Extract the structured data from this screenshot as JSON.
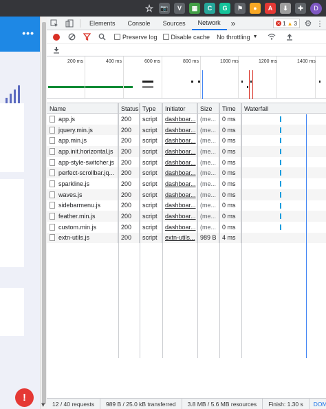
{
  "browser": {
    "extensions": [
      {
        "name": "star-icon",
        "glyph": "☆",
        "bg": "transparent"
      },
      {
        "name": "camera-extension-icon",
        "glyph": "📷",
        "bg": "#5f6368"
      },
      {
        "name": "italic-v-extension-icon",
        "glyph": "V",
        "bg": "#5f6368"
      },
      {
        "name": "grid-extension-icon",
        "glyph": "▦",
        "bg": "#43a047"
      },
      {
        "name": "c-extension-icon",
        "glyph": "C",
        "bg": "#26a69a"
      },
      {
        "name": "grammarly-extension-icon",
        "glyph": "G",
        "bg": "#15c39a"
      },
      {
        "name": "flag-extension-icon",
        "glyph": "⚑",
        "bg": "#5f6368"
      },
      {
        "name": "honey-extension-icon",
        "glyph": "●",
        "bg": "#f9a825"
      },
      {
        "name": "pdf-extension-icon",
        "glyph": "A",
        "bg": "#e53935"
      },
      {
        "name": "download-extension-icon",
        "glyph": "⬇",
        "bg": "#9e9e9e"
      },
      {
        "name": "puzzle-extension-icon",
        "glyph": "✚",
        "bg": "#5f6368"
      }
    ],
    "avatar_letter": "D"
  },
  "page": {
    "menu_dots": "•••",
    "alert_glyph": "!"
  },
  "devtools": {
    "tabs": [
      {
        "name": "tab-elements",
        "label": "Elements",
        "active": false
      },
      {
        "name": "tab-console",
        "label": "Console",
        "active": false
      },
      {
        "name": "tab-sources",
        "label": "Sources",
        "active": false
      },
      {
        "name": "tab-network",
        "label": "Network",
        "active": true
      }
    ],
    "more_tabs": "»",
    "errors": "1",
    "warnings": "3",
    "toolbar": {
      "preserve_log": "Preserve log",
      "disable_cache": "Disable cache",
      "throttling": "No throttling"
    },
    "overview_ticks": [
      "200 ms",
      "400 ms",
      "600 ms",
      "800 ms",
      "1000 ms",
      "1200 ms",
      "1400 ms"
    ],
    "columns": {
      "name": "Name",
      "status": "Status",
      "type": "Type",
      "initiator": "Initiator",
      "size": "Size",
      "time": "Time",
      "waterfall": "Waterfall"
    },
    "requests": [
      {
        "name": "app.js",
        "status": "200",
        "type": "script",
        "initiator": "dashboar...",
        "size": "(me...",
        "time": "0 ms"
      },
      {
        "name": "jquery.min.js",
        "status": "200",
        "type": "script",
        "initiator": "dashboar...",
        "size": "(me...",
        "time": "0 ms"
      },
      {
        "name": "app.min.js",
        "status": "200",
        "type": "script",
        "initiator": "dashboar...",
        "size": "(me...",
        "time": "0 ms"
      },
      {
        "name": "app.init.horizontal.js",
        "status": "200",
        "type": "script",
        "initiator": "dashboar...",
        "size": "(me...",
        "time": "0 ms"
      },
      {
        "name": "app-style-switcher.js",
        "status": "200",
        "type": "script",
        "initiator": "dashboar...",
        "size": "(me...",
        "time": "0 ms"
      },
      {
        "name": "perfect-scrollbar.jq...",
        "status": "200",
        "type": "script",
        "initiator": "dashboar...",
        "size": "(me...",
        "time": "0 ms"
      },
      {
        "name": "sparkline.js",
        "status": "200",
        "type": "script",
        "initiator": "dashboar...",
        "size": "(me...",
        "time": "0 ms"
      },
      {
        "name": "waves.js",
        "status": "200",
        "type": "script",
        "initiator": "dashboar...",
        "size": "(me...",
        "time": "0 ms"
      },
      {
        "name": "sidebarmenu.js",
        "status": "200",
        "type": "script",
        "initiator": "dashboar...",
        "size": "(me...",
        "time": "0 ms"
      },
      {
        "name": "feather.min.js",
        "status": "200",
        "type": "script",
        "initiator": "dashboar...",
        "size": "(me...",
        "time": "0 ms"
      },
      {
        "name": "custom.min.js",
        "status": "200",
        "type": "script",
        "initiator": "dashboar...",
        "size": "(me...",
        "time": "0 ms"
      },
      {
        "name": "extn-utils.js",
        "status": "200",
        "type": "script",
        "initiator": "extn-utils...",
        "size": "989 B",
        "time": "4 ms"
      }
    ],
    "statusbar": {
      "requests": "12 / 40 requests",
      "transferred": "989 B / 25.0 kB transferred",
      "resources": "3.8 MB / 5.6 MB resources",
      "finish": "Finish: 1.30 s",
      "dom": "DOM"
    }
  }
}
